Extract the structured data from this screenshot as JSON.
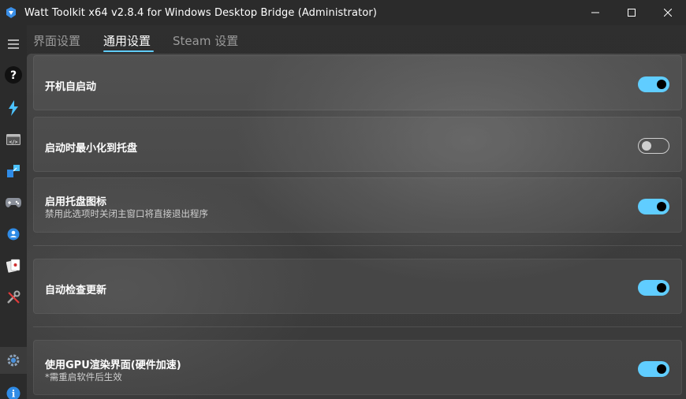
{
  "window": {
    "title": "Watt Toolkit x64 v2.8.4 for Windows Desktop Bridge (Administrator)",
    "controls": [
      "minimize",
      "maximize",
      "close"
    ]
  },
  "sidebar": {
    "items": [
      {
        "icon": "menu-icon"
      },
      {
        "icon": "help-icon",
        "glyph": "?"
      },
      {
        "icon": "lightning-icon"
      },
      {
        "icon": "code-window-icon"
      },
      {
        "icon": "puzzle-arrows-icon"
      },
      {
        "icon": "gamepad-icon"
      },
      {
        "icon": "user-shield-icon"
      },
      {
        "icon": "cards-icon"
      },
      {
        "icon": "tools-icon"
      },
      {
        "icon": "settings-gear-icon"
      },
      {
        "icon": "info-icon",
        "glyph": "i"
      }
    ]
  },
  "tabs": [
    {
      "label": "界面设置",
      "active": false
    },
    {
      "label": "通用设置",
      "active": true
    },
    {
      "label": "Steam 设置",
      "active": false
    }
  ],
  "settings": [
    {
      "title": "开机自启动",
      "subtitle": "",
      "enabled": true
    },
    {
      "title": "启动时最小化到托盘",
      "subtitle": "",
      "enabled": false
    },
    {
      "title": "启用托盘图标",
      "subtitle": "禁用此选项时关闭主窗口将直接退出程序",
      "enabled": true
    },
    {
      "title": "自动检查更新",
      "subtitle": "",
      "enabled": true
    },
    {
      "title": "使用GPU渲染界面(硬件加速)",
      "subtitle": "*需重启软件后生效",
      "enabled": true
    }
  ],
  "colors": {
    "accent": "#60cdff",
    "background": "#2b2b2b",
    "card": "#4a4a4a",
    "text": "#ffffff"
  }
}
